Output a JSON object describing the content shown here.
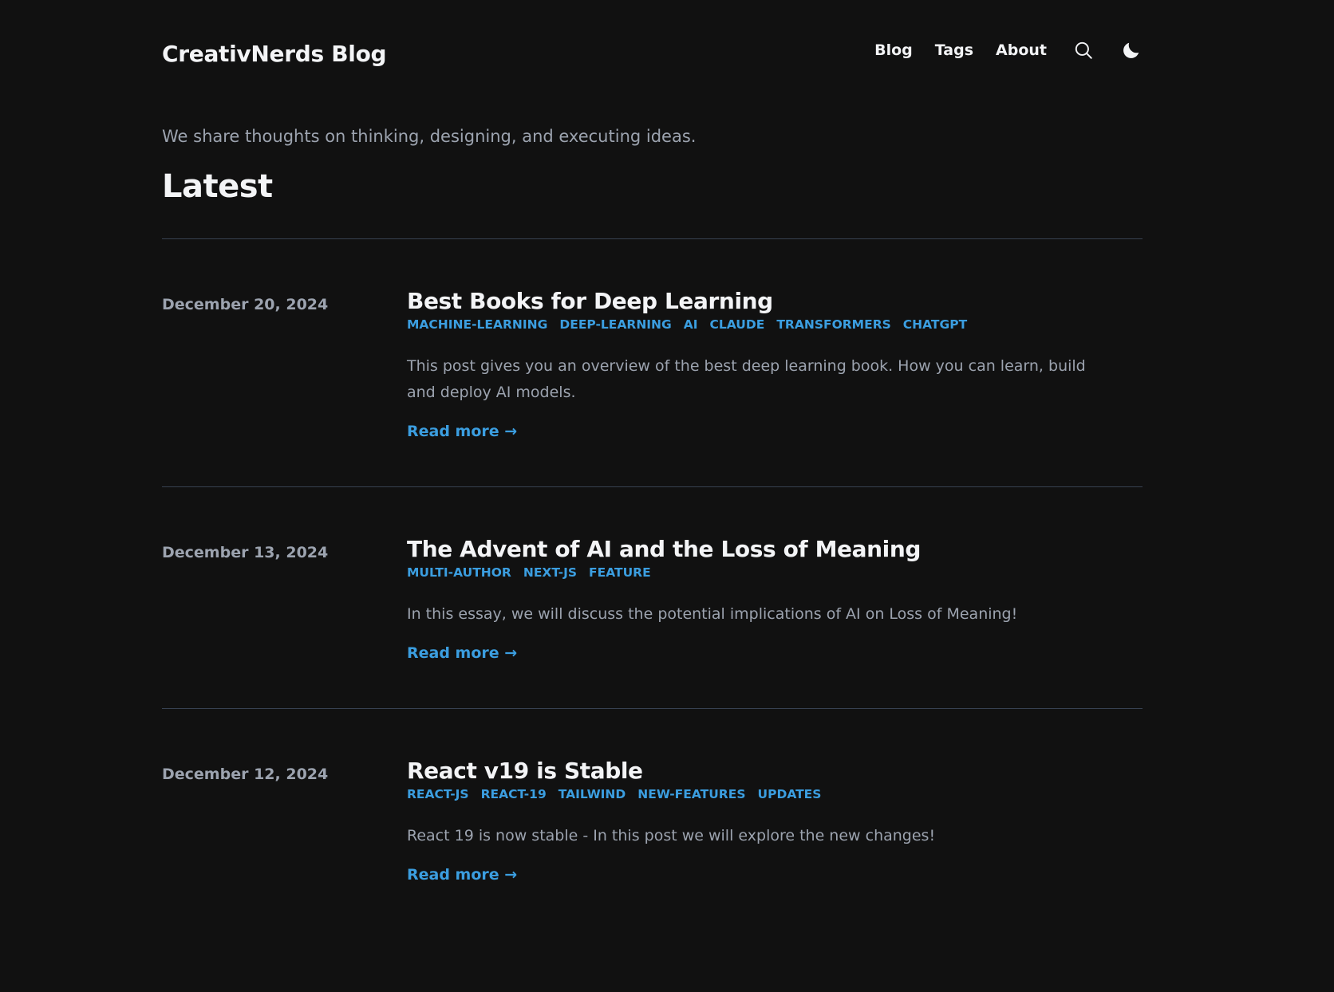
{
  "site": {
    "logo": "CreativNerds Blog",
    "nav": [
      {
        "label": "Blog"
      },
      {
        "label": "Tags"
      },
      {
        "label": "About"
      }
    ],
    "icons": {
      "search": "search-icon",
      "theme": "moon-icon"
    }
  },
  "hero": {
    "tagline": "We share thoughts on thinking, designing, and executing ideas.",
    "heading": "Latest"
  },
  "posts": [
    {
      "date": "December 20, 2024",
      "title": "Best Books for Deep Learning",
      "tags": [
        "MACHINE-LEARNING",
        "DEEP-LEARNING",
        "AI",
        "CLAUDE",
        "TRANSFORMERS",
        "CHATGPT"
      ],
      "summary": "This post gives you an overview of the best deep learning book. How you can learn, build and deploy AI models.",
      "read_more": "Read more →"
    },
    {
      "date": "December 13, 2024",
      "title": "The Advent of AI and the Loss of Meaning",
      "tags": [
        "MULTI-AUTHOR",
        "NEXT-JS",
        "FEATURE"
      ],
      "summary": "In this essay, we will discuss the potential implications of AI on Loss of Meaning!",
      "read_more": "Read more →"
    },
    {
      "date": "December 12, 2024",
      "title": "React v19 is Stable",
      "tags": [
        "REACT-JS",
        "REACT-19",
        "TAILWIND",
        "NEW-FEATURES",
        "UPDATES"
      ],
      "summary": "React 19 is now stable - In this post we will explore the new changes!",
      "read_more": "Read more →"
    }
  ],
  "colors": {
    "background": "#111111",
    "accent": "#3b9ee0",
    "muted": "#9ca3af",
    "divider": "#374151"
  }
}
